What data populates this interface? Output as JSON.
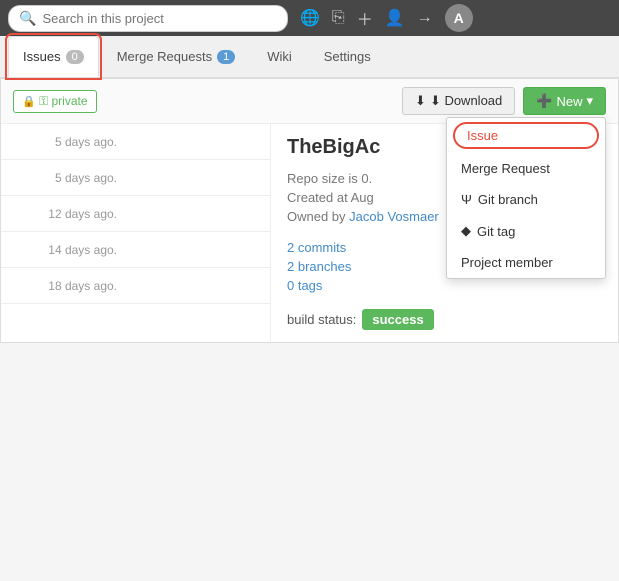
{
  "header": {
    "search_placeholder": "Search in this project",
    "icons": [
      "globe",
      "copy",
      "plus",
      "user",
      "arrow"
    ],
    "avatar_text": "A"
  },
  "nav": {
    "tabs": [
      {
        "label": "Issues",
        "badge": "0",
        "active": true
      },
      {
        "label": "Merge Requests",
        "badge": "1",
        "active": false
      },
      {
        "label": "Wiki",
        "badge": "",
        "active": false
      },
      {
        "label": "Settings",
        "badge": "",
        "active": false
      }
    ]
  },
  "toolbar": {
    "private_label": "⚿ private",
    "download_label": "⬇ Download",
    "new_label": "✚ New ▾"
  },
  "dropdown": {
    "items": [
      {
        "label": "Issue",
        "highlighted": true
      },
      {
        "label": "Merge Request",
        "highlighted": false
      },
      {
        "label": "ψ Git branch",
        "highlighted": false
      },
      {
        "label": "⬥ Git tag",
        "highlighted": false
      },
      {
        "label": "Project member",
        "highlighted": false
      }
    ]
  },
  "rows": [
    {
      "time": "5 days ago.",
      "content": ""
    },
    {
      "time": "5 days ago.",
      "content": ""
    },
    {
      "time": "12 days ago.",
      "content": ""
    },
    {
      "time": "14 days ago.",
      "content": ""
    },
    {
      "time": "18 days ago.",
      "content": ""
    }
  ],
  "project": {
    "title": "TheBigAc",
    "repo_size": "Repo size is 0.",
    "created": "Created at Aug",
    "owned_by": "Owned by Jacob Vosmaer",
    "owned_link": "Jacob Vosmaer"
  },
  "stats": {
    "commits": "2 commits",
    "branches": "2 branches",
    "tags": "0 tags"
  },
  "build": {
    "label": "build status:",
    "status": "success"
  }
}
